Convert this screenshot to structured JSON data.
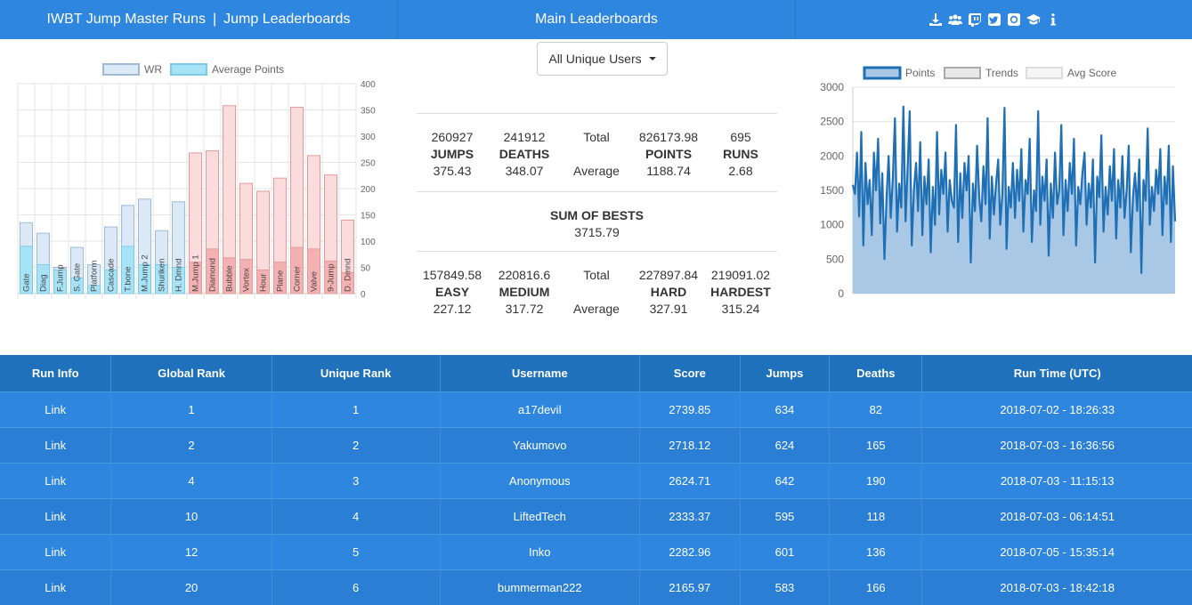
{
  "nav": {
    "site_title": "IWBT Jump Master Runs",
    "separator": "|",
    "section_title": "Jump Leaderboards",
    "main_title": "Main Leaderboards",
    "icons": [
      "download-icon",
      "users-icon",
      "twitch-icon",
      "twitter-icon",
      "github-icon",
      "graduation-cap-icon",
      "info-icon"
    ]
  },
  "dropdown": {
    "label": "All Unique Users"
  },
  "stats": {
    "total_label": "Total",
    "average_label": "Average",
    "row1": [
      {
        "total": "260927",
        "label": "JUMPS",
        "average": "375.43"
      },
      {
        "total": "241912",
        "label": "DEATHS",
        "average": "348.07"
      },
      {
        "total": "826173.98",
        "label": "POINTS",
        "average": "1188.74"
      },
      {
        "total": "695",
        "label": "RUNS",
        "average": "2.68"
      }
    ],
    "sum_of_bests_label": "SUM OF BESTS",
    "sum_of_bests_value": "3715.79",
    "row2": [
      {
        "total": "157849.58",
        "label": "EASY",
        "average": "227.12"
      },
      {
        "total": "220816.6",
        "label": "MEDIUM",
        "average": "317.72"
      },
      {
        "total": "227897.84",
        "label": "HARD",
        "average": "327.91"
      },
      {
        "total": "219091.02",
        "label": "HARDEST",
        "average": "315.24"
      }
    ]
  },
  "chart_data": [
    {
      "type": "bar",
      "legend": [
        "WR",
        "Average Points"
      ],
      "legend_position": "top",
      "y_axis_position": "right",
      "ylim": [
        0,
        400
      ],
      "yticks": [
        0,
        50,
        100,
        150,
        200,
        250,
        300,
        350,
        400
      ],
      "categories": [
        "Gate",
        "Diag",
        "F.Jump",
        "S. Gate",
        "Platform",
        "Cascade",
        "T.bone",
        "M.Jump 2",
        "Shuriken",
        "H. Dmnd",
        "M.Jump 1",
        "Diamond",
        "Bubble",
        "Vortex",
        "Hour",
        "Plane",
        "Corner",
        "Valve",
        "9-Jump",
        "D. Dmnd"
      ],
      "category_groups": [
        "blue",
        "blue",
        "blue",
        "blue",
        "blue",
        "blue",
        "blue",
        "blue",
        "blue",
        "blue",
        "red",
        "red",
        "red",
        "red",
        "red",
        "red",
        "red",
        "red",
        "red",
        "red"
      ],
      "series": [
        {
          "name": "WR",
          "values": [
            135,
            115,
            50,
            88,
            55,
            127,
            168,
            180,
            120,
            175,
            268,
            272,
            358,
            210,
            195,
            220,
            355,
            263,
            226,
            140
          ]
        },
        {
          "name": "Average Points",
          "values": [
            90,
            55,
            45,
            30,
            15,
            45,
            90,
            55,
            55,
            50,
            60,
            85,
            68,
            65,
            45,
            60,
            88,
            85,
            62,
            40
          ]
        }
      ],
      "colors": {
        "blue_wr": "#dbe9f6",
        "blue_avg": "#a6e3f7",
        "red_wr": "#fadcdc",
        "red_avg": "#f4b1b1",
        "blue_border": "#9ebcd8",
        "red_border": "#e59a9a"
      }
    },
    {
      "type": "area",
      "legend": [
        "Points",
        "Trends",
        "Avg Score"
      ],
      "legend_position": "top",
      "ylim": [
        0,
        3000
      ],
      "yticks": [
        0,
        500,
        1000,
        1500,
        2000,
        2500,
        3000
      ],
      "series": [
        {
          "name": "Points",
          "values": [
            1580,
            1450,
            2050,
            1120,
            2350,
            700,
            1900,
            1300,
            1650,
            850,
            2050,
            1500,
            2250,
            1020,
            1750,
            500,
            1400,
            2000,
            1100,
            1700,
            2550,
            900,
            1600,
            1250,
            2720,
            1050,
            1800,
            2650,
            700,
            1500,
            1900,
            1200,
            2200,
            850,
            1700,
            1300,
            1950,
            600,
            1550,
            1000,
            2350,
            1150,
            1800,
            1450,
            2050,
            900,
            1650,
            1350,
            1250,
            2450,
            750,
            1750,
            1100,
            1900,
            1500,
            2000,
            450,
            1600,
            1200,
            2150,
            1400,
            1050,
            1850,
            1300,
            2550,
            800,
            1700,
            1150,
            1600,
            1950,
            1000,
            1450,
            2700,
            650,
            1550,
            1250,
            1900,
            1100,
            1800,
            1350,
            2100,
            900,
            1650,
            1450,
            2250,
            750,
            1500,
            1200,
            2650,
            1000,
            1700,
            1350,
            1950,
            550,
            1600,
            1100,
            2050,
            1300,
            1500,
            2450,
            850,
            1650,
            1200,
            1900,
            1450,
            2250,
            700,
            1550,
            1300,
            1750,
            2050,
            1000,
            1600,
            1250,
            1950,
            450,
            1700,
            1400,
            2300,
            900,
            1550,
            1150,
            1850,
            1350,
            2100,
            800,
            1650,
            1250,
            2000,
            1100,
            1500,
            2150,
            600,
            1400,
            1750,
            1200,
            1950,
            300,
            1650,
            1350,
            2400,
            1000,
            1550,
            1200,
            1800,
            1450,
            2100,
            850,
            1700,
            1300,
            2150,
            750,
            1850,
            1050
          ]
        },
        {
          "name": "Trends",
          "values": []
        },
        {
          "name": "Avg Score",
          "values": []
        }
      ],
      "colors": {
        "points_fill": "#a8c8e6",
        "points_line": "#1f6fb5",
        "trends": "#c8c8c8",
        "avg_score": "#eeeeee"
      }
    }
  ],
  "table": {
    "headers": [
      "Run Info",
      "Global Rank",
      "Unique Rank",
      "Username",
      "Score",
      "Jumps",
      "Deaths",
      "Run Time (UTC)"
    ],
    "rows": [
      [
        "Link",
        "1",
        "1",
        "a17devil",
        "2739.85",
        "634",
        "82",
        "2018-07-02 - 18:26:33"
      ],
      [
        "Link",
        "2",
        "2",
        "Yakumovo",
        "2718.12",
        "624",
        "165",
        "2018-07-03 - 16:36:56"
      ],
      [
        "Link",
        "4",
        "3",
        "Anonymous",
        "2624.71",
        "642",
        "190",
        "2018-07-03 - 11:15:13"
      ],
      [
        "Link",
        "10",
        "4",
        "LiftedTech",
        "2333.37",
        "595",
        "118",
        "2018-07-03 - 06:14:51"
      ],
      [
        "Link",
        "12",
        "5",
        "Inko",
        "2282.96",
        "601",
        "136",
        "2018-07-05 - 15:35:14"
      ],
      [
        "Link",
        "20",
        "6",
        "bummerman222",
        "2165.97",
        "583",
        "166",
        "2018-07-03 - 18:42:18"
      ]
    ]
  }
}
